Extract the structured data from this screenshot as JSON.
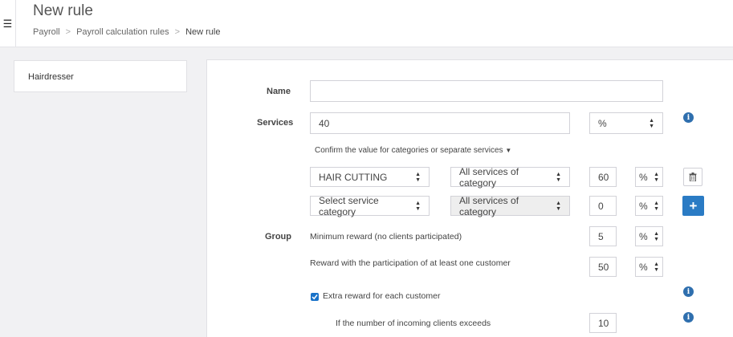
{
  "header": {
    "menu_icon": "☰",
    "title": "New rule",
    "breadcrumb": [
      {
        "label": "Payroll"
      },
      {
        "label": "Payroll calculation rules"
      },
      {
        "label": "New rule"
      }
    ],
    "separator": ">"
  },
  "sidebar": {
    "items": [
      {
        "label": "Hairdresser"
      }
    ]
  },
  "form": {
    "name": {
      "label": "Name",
      "value": ""
    },
    "services": {
      "label": "Services",
      "value": "40",
      "unit": "%",
      "confirm_link": "Confirm the value for categories or separate services",
      "rows": [
        {
          "category": "HAIR CUTTING",
          "scope": "All services of category",
          "value": "60",
          "unit": "%"
        },
        {
          "category": "Select service category",
          "scope": "All services of category",
          "value": "0",
          "unit": "%"
        }
      ],
      "add_label": "+"
    },
    "group": {
      "label": "Group",
      "min_reward_label": "Minimum reward (no clients participated)",
      "min_reward_value": "5",
      "min_reward_unit": "%",
      "reward_participation_label": "Reward with the participation of at least one customer",
      "reward_participation_value": "50",
      "reward_participation_unit": "%",
      "extra_reward_label": "Extra reward for each customer",
      "extra_reward_checked": true,
      "clients_exceed_label": "If the number of incoming clients exceeds",
      "clients_exceed_value": "10"
    }
  },
  "colors": {
    "accent": "#2a7bc4",
    "info": "#2f6fae",
    "checkbox": "#1a73c9"
  }
}
